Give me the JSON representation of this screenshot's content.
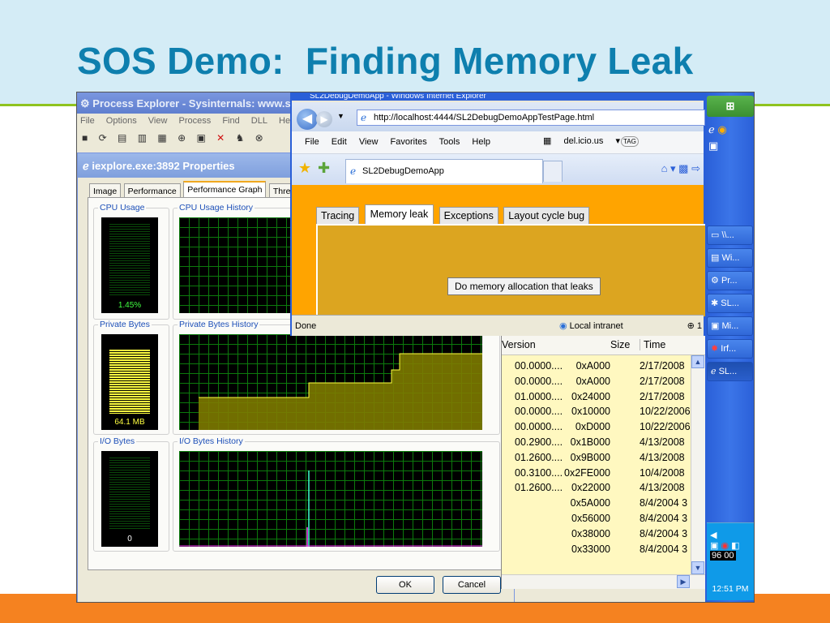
{
  "slide": {
    "title": "SOS Demo:  Finding Memory Leak",
    "colors": {
      "top_band": "#d4ecf6",
      "accent_line": "#8fc31f",
      "bottom_band": "#f58220",
      "title": "#0e7fae"
    }
  },
  "process_explorer": {
    "title": "Process Explorer - Sysinternals: www.s",
    "menu": [
      "File",
      "Options",
      "View",
      "Process",
      "Find",
      "DLL",
      "Help"
    ]
  },
  "properties": {
    "title": "iexplore.exe:3892 Properties",
    "tabs": [
      "Image",
      "Performance",
      "Performance Graph",
      "Thread"
    ],
    "groups": {
      "cpu_usage": "CPU Usage",
      "cpu_history": "CPU Usage History",
      "private_bytes": "Private Bytes",
      "private_history": "Private Bytes History",
      "io_bytes": "I/O Bytes",
      "io_history": "I/O Bytes History"
    },
    "readings": {
      "cpu": "1.45%",
      "private": "64.1 MB",
      "io": "0"
    },
    "private_fill_percent": 88,
    "buttons": {
      "ok": "OK",
      "cancel": "Cancel"
    }
  },
  "ie": {
    "title": "SL2DebugDemoApp - Windows Internet Explorer",
    "address": "http://localhost:4444/SL2DebugDemoAppTestPage.html",
    "menu": [
      "File",
      "Edit",
      "View",
      "Favorites",
      "Tools",
      "Help"
    ],
    "delicious": "del.icio.us",
    "tag_label": "TAG",
    "tab_title": "SL2DebugDemoApp",
    "app_tabs": [
      "Tracing",
      "Memory leak",
      "Exceptions",
      "Layout cycle bug"
    ],
    "selected_tab": "Memory leak",
    "leak_button": "Do memory allocation that leaks",
    "status": {
      "done": "Done",
      "zone": "Local intranet",
      "zoom": "1"
    }
  },
  "module_list": {
    "headers": {
      "version": "Version",
      "size": "Size",
      "time": "Time"
    },
    "rows": [
      {
        "version": "00.0000....",
        "size": "0xA000",
        "time": "2/17/2008"
      },
      {
        "version": "00.0000....",
        "size": "0xA000",
        "time": "2/17/2008"
      },
      {
        "version": "01.0000....",
        "size": "0x24000",
        "time": "2/17/2008"
      },
      {
        "version": "00.0000....",
        "size": "0x10000",
        "time": "10/22/2006"
      },
      {
        "version": "00.0000....",
        "size": "0xD000",
        "time": "10/22/2006"
      },
      {
        "version": "00.2900....",
        "size": "0x1B000",
        "time": "4/13/2008"
      },
      {
        "version": "01.2600....",
        "size": "0x9B000",
        "time": "4/13/2008"
      },
      {
        "version": "00.3100....",
        "size": "0x2FE000",
        "time": "10/4/2008"
      },
      {
        "version": "01.2600....",
        "size": "0x22000",
        "time": "4/13/2008"
      },
      {
        "version": "",
        "size": "0x5A000",
        "time": "8/4/2004 3"
      },
      {
        "version": "",
        "size": "0x56000",
        "time": "8/4/2004 3"
      },
      {
        "version": "",
        "size": "0x38000",
        "time": "8/4/2004 3"
      },
      {
        "version": "",
        "size": "0x33000",
        "time": "8/4/2004 3"
      }
    ]
  },
  "taskbar": {
    "items": [
      "\\\\...",
      "Wi...",
      "Pr...",
      "SL...",
      "Mi...",
      "Irf...",
      "SL..."
    ],
    "clock": "12:51 PM",
    "tray_text": "96 00"
  }
}
